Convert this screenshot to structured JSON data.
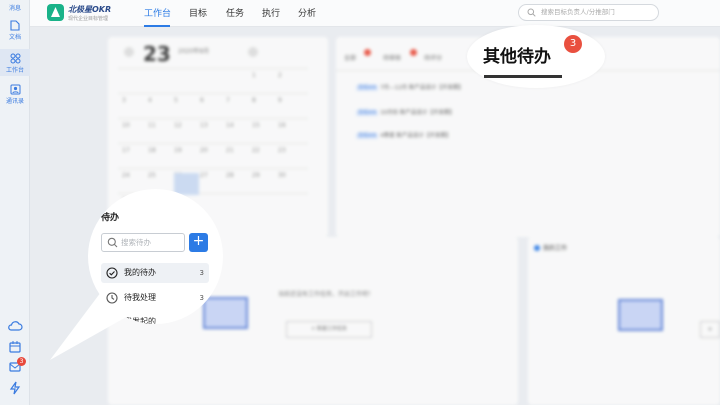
{
  "sidebar": {
    "items": [
      {
        "label": "消息",
        "icon": "message-icon"
      },
      {
        "label": "文档",
        "icon": "document-icon"
      },
      {
        "label": "工作台",
        "icon": "workbench-icon"
      },
      {
        "label": "通讯录",
        "icon": "contacts-icon"
      }
    ],
    "bottom_icons": [
      "cloud-icon",
      "calendar-icon",
      "mail-icon",
      "lightning-icon"
    ],
    "mail_badge": "3"
  },
  "header": {
    "logo_title": "北极星OKR",
    "logo_subtitle": "现代企业目标管理",
    "nav": [
      "工作台",
      "目标",
      "任务",
      "执行",
      "分析"
    ],
    "active_nav": "工作台",
    "search_placeholder": "搜索目标负责人/分推部门"
  },
  "calendar": {
    "big_day": "23",
    "month_label": "2020年8月",
    "rows": [
      [
        "",
        "",
        "",
        "",
        "",
        "1",
        "2"
      ],
      [
        "3",
        "4",
        "5",
        "6",
        "7",
        "8",
        "9"
      ],
      [
        "10",
        "11",
        "12",
        "13",
        "14",
        "15",
        "16"
      ],
      [
        "17",
        "18",
        "19",
        "20",
        "21",
        "22",
        "23"
      ],
      [
        "24",
        "25",
        "26",
        "27",
        "28",
        "29",
        "30"
      ],
      [
        "31",
        "",
        "",
        "",
        "",
        "",
        ""
      ]
    ]
  },
  "tasks_panel": {
    "tabs": [
      "全部",
      "待审核",
      "待评分"
    ],
    "rows": [
      {
        "tag": "目标KR",
        "text": "7月—12月 新产品设计【开发期】"
      },
      {
        "tag": "目标KR",
        "text": "10月份 新产品设计【开发期】"
      },
      {
        "tag": "目标KR",
        "text": "4季度 新产品设计【开发期】"
      }
    ]
  },
  "bottom_cards": [
    {
      "title": "我的工作",
      "hint": "当前还没有工作任务，开启工作吧！",
      "button": "+ 新建工作任务"
    },
    {
      "title": "",
      "hint": "",
      "button": "+"
    }
  ],
  "callout_top": {
    "title": "其他待办",
    "badge": "3"
  },
  "callout_left": {
    "title": "待办",
    "search_placeholder": "搜索待办",
    "add_label": "+",
    "items": [
      {
        "label": "我的待办",
        "count": "3",
        "icon": "check-circle-icon"
      },
      {
        "label": "待我处理",
        "count": "3",
        "icon": "clock-icon"
      },
      {
        "label": "我发起的",
        "count": "",
        "icon": "send-icon"
      }
    ]
  },
  "colors": {
    "accent": "#2c7be5",
    "badge": "#e9503f",
    "logo": "#19b289"
  }
}
